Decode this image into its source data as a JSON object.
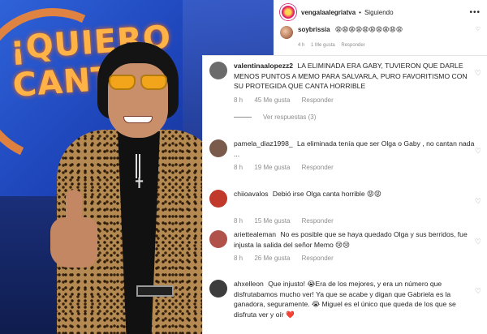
{
  "photo": {
    "sign_line1": "¡QUIERO",
    "sign_line2": "CANTAR"
  },
  "post": {
    "username": "vengalaalegriatva",
    "separator": "•",
    "follow_status": "Siguiendo",
    "more_icon": "more-horizontal-icon",
    "first_comment": {
      "username": "soybrissia",
      "text": "😩😩😩😩😩😩😩😩😩😩",
      "time": "4 h",
      "likes": "1 Me gusta",
      "reply": "Responder"
    }
  },
  "comments": [
    {
      "username": "valentinaalopezz2",
      "text": "LA ELIMINADA ERA GABY, TUVIERON QUE DARLE MENOS PUNTOS A MEMO PARA SALVARLA, PURO FAVORITISMO CON SU PROTEGIDA QUE CANTA HORRIBLE",
      "time": "8 h",
      "likes": "45 Me gusta",
      "reply": "Responder",
      "view_replies": "Ver respuestas (3)",
      "avatar_color": "#6b6b6b"
    },
    {
      "username": "pamela_diaz1998_",
      "text": "La eliminada tenía que ser Olga o Gaby , no cantan nada ...",
      "time": "8 h",
      "likes": "19 Me gusta",
      "reply": "Responder",
      "avatar_color": "#7a5a4a"
    },
    {
      "username": "chiioavalos",
      "text": "Debió irse Olga canta horrible 😡😡",
      "time": "8 h",
      "likes": "15 Me gusta",
      "reply": "Responder",
      "avatar_color": "#c0392b"
    },
    {
      "username": "ariettealeman",
      "text": "No es posible que se haya quedado Olga y sus berridos, fue injusta la salida del señor Memo 😢😢",
      "time": "8 h",
      "likes": "26 Me gusta",
      "reply": "Responder",
      "avatar_color": "#b0524a"
    },
    {
      "username": "ahxelleon",
      "text": "Que injusto! 😭Era de los mejores, y era un número que disfrutabamos mucho ver! Ya que se acabe y digan que Gabriela es la ganadora, seguramente. 😭 Miguel es el único que queda de los que se disfruta ver y oír ❤️",
      "avatar_color": "#3d3d3d"
    }
  ],
  "colors": {
    "text": "#262626",
    "meta": "#8e8e8e",
    "link_gold": "#ffb347"
  }
}
